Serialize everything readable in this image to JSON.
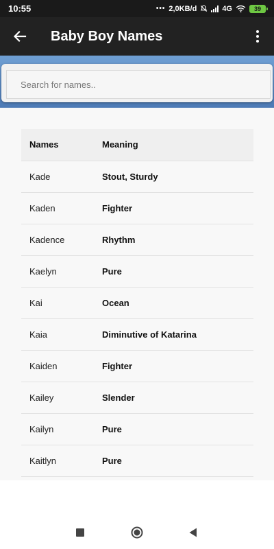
{
  "status_bar": {
    "time": "10:55",
    "dots": "•••",
    "network_speed": "2,0KB/d",
    "network_type": "4G",
    "battery": "39"
  },
  "app_bar": {
    "title": "Baby Boy Names",
    "back_icon": "arrow-back-icon",
    "menu_icon": "more-vertical-icon"
  },
  "search": {
    "placeholder": "Search for names..",
    "value": ""
  },
  "table": {
    "headers": {
      "name": "Names",
      "meaning": "Meaning"
    },
    "rows": [
      {
        "name": "Kade",
        "meaning": "Stout, Sturdy"
      },
      {
        "name": "Kaden",
        "meaning": "Fighter"
      },
      {
        "name": "Kadence",
        "meaning": "Rhythm"
      },
      {
        "name": "Kaelyn",
        "meaning": "Pure"
      },
      {
        "name": "Kai",
        "meaning": "Ocean"
      },
      {
        "name": "Kaia",
        "meaning": "Diminutive of Katarina"
      },
      {
        "name": "Kaiden",
        "meaning": "Fighter"
      },
      {
        "name": "Kailey",
        "meaning": "Slender"
      },
      {
        "name": "Kailyn",
        "meaning": "Pure"
      },
      {
        "name": "Kaitlyn",
        "meaning": "Pure"
      }
    ]
  },
  "nav_bar": {
    "icons": [
      "recents-square-icon",
      "home-circle-icon",
      "back-triangle-icon"
    ]
  },
  "colors": {
    "app_bar": "#222222",
    "status_bar": "#1a1a1a",
    "search_band": "#5b89c3",
    "battery": "#6ec843"
  }
}
